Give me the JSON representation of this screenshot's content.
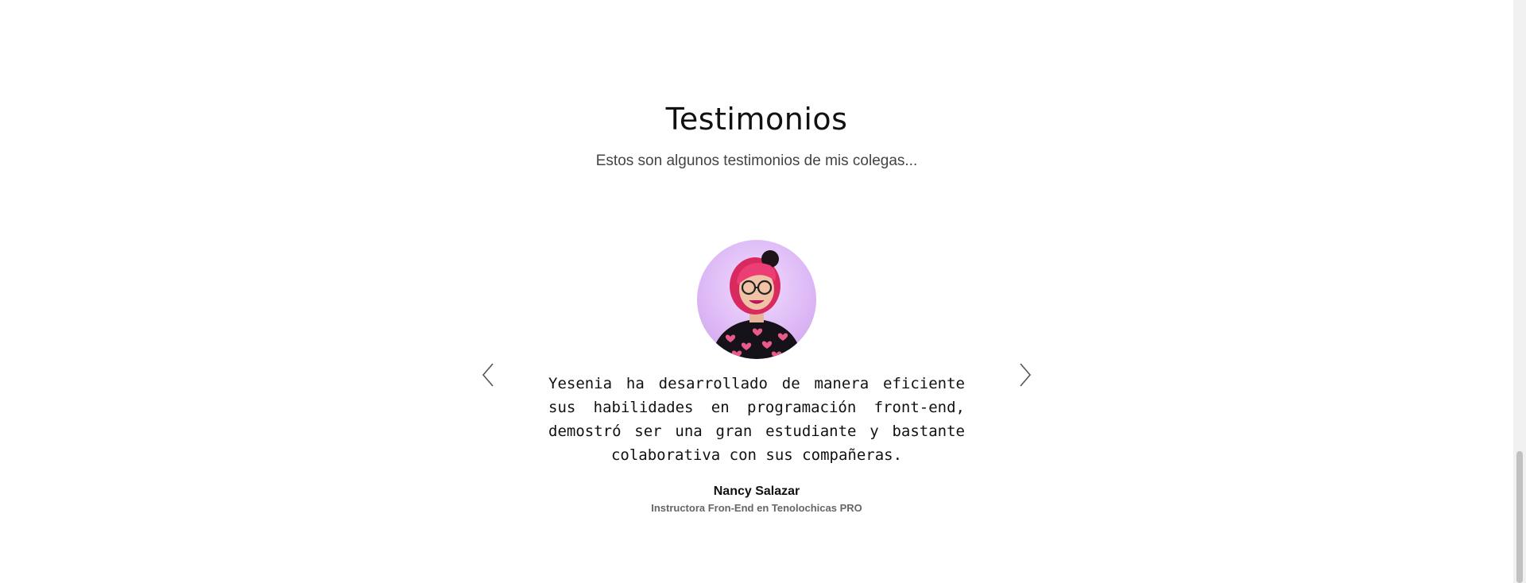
{
  "testimonials": {
    "title": "Testimonios",
    "subtitle": "Estos son algunos testimonios de mis colegas...",
    "current": {
      "quote": "Yesenia ha desarrollado de manera eficiente sus habilidades en programación front-end, demostró ser una gran estudiante y bastante colaborativa con sus compañeras.",
      "author": "Nancy Salazar",
      "role": "Instructora Fron-End en Tenolochicas PRO"
    },
    "controls": {
      "prev_icon": "chevron-left-icon",
      "next_icon": "chevron-right-icon"
    }
  },
  "colors": {
    "background": "#ffffff",
    "text": "#111111",
    "muted": "#666666",
    "avatar_bg": "#dcb7f5",
    "hair": "#e8336b"
  }
}
